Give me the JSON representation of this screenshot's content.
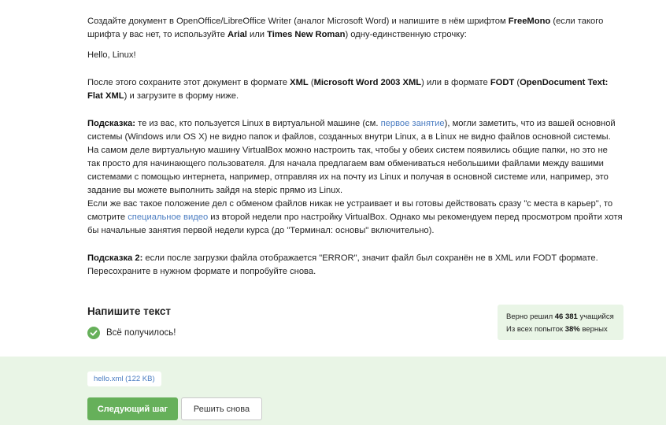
{
  "task": {
    "p1_a": "Создайте документ в OpenOffice/LibreOffice Writer (аналог Microsoft Word) и напишите в нём шрифтом ",
    "p1_font": "FreeMono",
    "p1_b": " (если такого шрифта у вас нет, то используйте ",
    "p1_arial": "Arial",
    "p1_c": " или ",
    "p1_tnr": "Times New Roman",
    "p1_d": ") одну-единственную строчку:",
    "hello": "Hello, Linux!",
    "save_a": "После этого сохраните этот документ в формате ",
    "save_xml": "XML",
    "save_b": " (",
    "save_msxml": "Microsoft Word 2003 XML",
    "save_c": ") или в формате ",
    "save_fodt": "FODT",
    "save_d": " (",
    "save_odt": "OpenDocument Text: Flat XML",
    "save_e": ") и загрузите в форму ниже.",
    "hint_label": "Подсказка:",
    "hint_a": " те из вас, кто пользуется Linux в виртуальной машине (см. ",
    "hint_link1": "первое занятие",
    "hint_b": "), могли заметить, что из вашей основной системы (Windows или OS X) не видно папок и файлов, созданных внутри Linux, а в Linux не видно файлов основной системы. На самом деле виртуальную машину VirtualBox можно настроить так, чтобы у обеих систем появились общие папки, но это не так просто для начинающего пользователя. Для начала предлагаем вам обмениваться небольшими файлами между вашими системами с помощью интернета, например, отправляя их на почту из Linux и получая в основной системе или, например, это задание вы можете выполнить зайдя на stepic прямо из Linux.",
    "hint_c": "Если же вас такое положение дел с обменом файлов никак не устраивает и вы готовы действовать сразу \"с места в карьер\", то смотрите ",
    "hint_link2": "специальное видео",
    "hint_d": " из второй недели про настройку VirtualBox. Однако мы рекомендуем перед просмотром пройти хотя бы начальные занятия первой недели курса (до \"Терминал: основы\" включительно).",
    "hint2_label": "Подсказка 2:",
    "hint2_text": " если после загрузки файла отображается \"ERROR\", значит файл был сохранён не в XML или FODT формате. Пересохраните в нужном формате и попробуйте снова."
  },
  "answer": {
    "title": "Напишите текст",
    "status": "Всё получилось!"
  },
  "stats": {
    "solved_prefix": "Верно решил ",
    "solved_count": "46 381",
    "solved_suffix": " учащийся",
    "attempts_prefix": "Из всех попыток ",
    "attempts_pct": "38%",
    "attempts_suffix": " верных"
  },
  "file": {
    "label": "hello.xml (122 KB)"
  },
  "buttons": {
    "next": "Следующий шаг",
    "retry": "Решить снова"
  },
  "colors": {
    "accent_green": "#66b05a",
    "light_green_bg": "#e9f5e6",
    "link_blue": "#4a7cc1"
  }
}
